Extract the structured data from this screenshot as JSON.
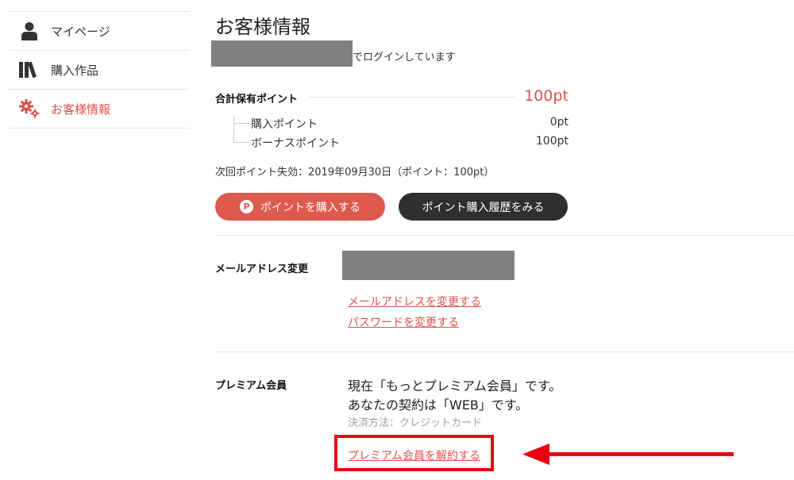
{
  "sidebar": {
    "items": [
      {
        "label": "マイページ",
        "icon": "user-icon",
        "active": false
      },
      {
        "label": "購入作品",
        "icon": "books-icon",
        "active": false
      },
      {
        "label": "お客様情報",
        "icon": "gears-icon",
        "active": true
      }
    ]
  },
  "main": {
    "title": "お客様情報",
    "login_suffix": "でログインしています",
    "points": {
      "total_label": "合計保有ポイント",
      "total_value": "100pt",
      "items": [
        {
          "label": "購入ポイント",
          "value": "0pt"
        },
        {
          "label": "ボーナスポイント",
          "value": "100pt"
        }
      ],
      "expiry": "次回ポイント失効：2019年09月30日（ポイント：100pt）",
      "buy_button": "ポイントを購入する",
      "buy_icon_letter": "P",
      "history_button": "ポイント購入履歴をみる"
    },
    "email": {
      "label": "メールアドレス変更",
      "change_email_link": "メールアドレスを変更する",
      "change_password_link": "パスワードを変更する"
    },
    "premium": {
      "label": "プレミアム会員",
      "status_line": "現在「もっとプレミアム会員」です。",
      "contract_line": "あなたの契約は「WEB」です。",
      "payment_method": "決済方法：クレジットカード",
      "cancel_link": "プレミアム会員を解約する"
    }
  },
  "colors": {
    "accent": "#d9534a",
    "dark_button": "#2f2f2f",
    "annotation": "#e60012",
    "mask": "#808080"
  }
}
